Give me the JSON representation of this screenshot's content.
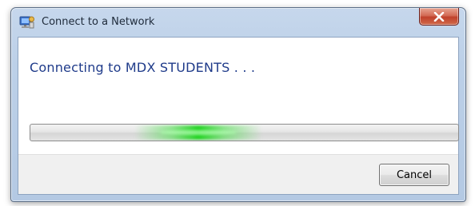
{
  "window": {
    "title": "Connect to a Network",
    "title_icon": "network-icon",
    "close_icon": "close-icon"
  },
  "main": {
    "heading": "Connecting to MDX STUDENTS . . .",
    "progress": {
      "mode": "indeterminate",
      "glow_color": "#28d228"
    }
  },
  "footer": {
    "cancel_label": "Cancel"
  },
  "colors": {
    "heading": "#1f3b8a",
    "close_button": "#c0412b",
    "frame": "#bcd0e8"
  }
}
